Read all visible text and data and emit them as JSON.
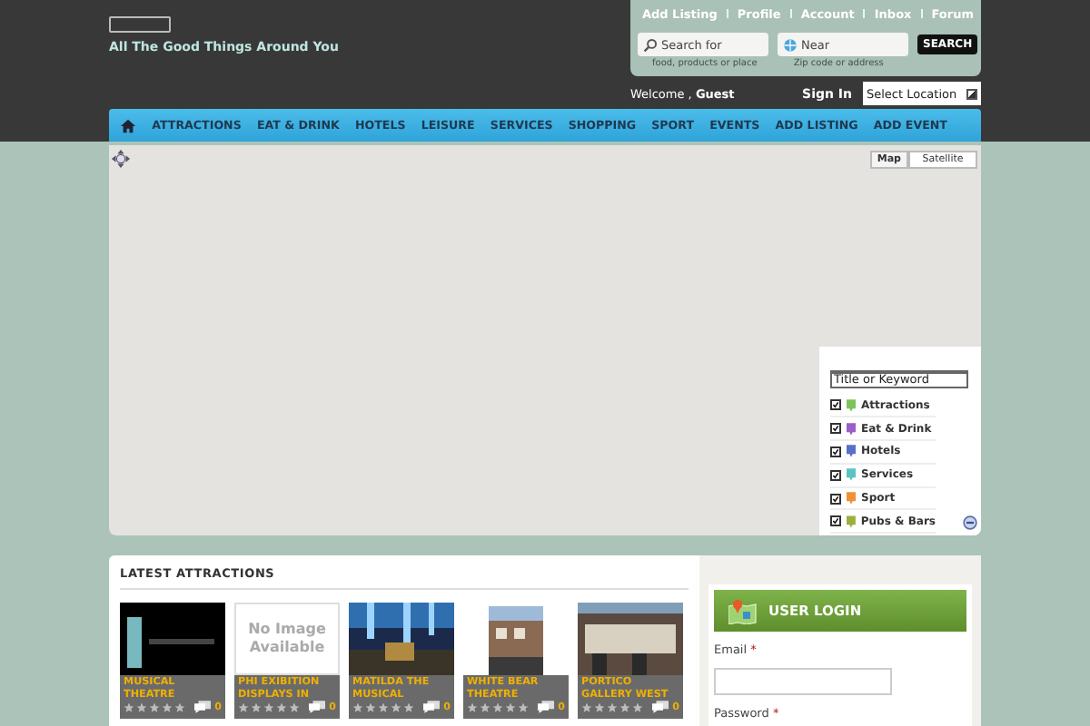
{
  "header": {
    "tagline": "All The Good Things Around You",
    "top_links": [
      "Add Listing",
      "Profile",
      "Account",
      "Inbox",
      "Forum"
    ],
    "search": {
      "what": {
        "placeholder": "Search for",
        "hint": "food, products or place"
      },
      "where": {
        "placeholder": "Near",
        "hint": "Zip code or address"
      },
      "button": "SEARCH"
    },
    "welcome": {
      "label": "Welcome ,",
      "user": "Guest"
    },
    "sign_in": "Sign In",
    "location_select": "Select Location"
  },
  "nav": [
    "ATTRACTIONS",
    "EAT & DRINK",
    "HOTELS",
    "LEISURE",
    "SERVICES",
    "SHOPPING",
    "SPORT",
    "EVENTS",
    "ADD LISTING",
    "ADD EVENT"
  ],
  "map": {
    "types": [
      {
        "label": "Map",
        "selected": true
      },
      {
        "label": "Satellite",
        "selected": false
      }
    ],
    "filter": {
      "placeholder": "Title or Keyword",
      "categories": [
        {
          "label": "Attractions",
          "checked": true,
          "color": "#7cc35a"
        },
        {
          "label": "Eat & Drink",
          "checked": true,
          "color": "#9b5fc8"
        },
        {
          "label": "Hotels",
          "checked": true,
          "color": "#5a6fc8"
        },
        {
          "label": "Services",
          "checked": true,
          "color": "#5ac4c4"
        },
        {
          "label": "Sport",
          "checked": true,
          "color": "#f09038"
        },
        {
          "label": "Pubs & Bars",
          "checked": true,
          "color": "#9ab03a"
        }
      ]
    }
  },
  "latest": {
    "title": "LATEST ATTRACTIONS",
    "items": [
      {
        "kind": "picture",
        "title": "MUSICAL THEATRE",
        "stars": 0,
        "comments": "0"
      },
      {
        "kind": "placeholder",
        "placeholder_text": "No Image Available",
        "title": "PHI EXIBITION DISPLAYS IN",
        "stars": 0,
        "comments": "0"
      },
      {
        "kind": "picture",
        "title": "MATILDA THE MUSICAL",
        "stars": 0,
        "comments": "0"
      },
      {
        "kind": "picture",
        "title": "WHITE BEAR THEATRE",
        "stars": 0,
        "comments": "0"
      },
      {
        "kind": "picture",
        "title": "PORTICO GALLERY WEST",
        "stars": 0,
        "comments": "0"
      }
    ]
  },
  "login": {
    "title": "USER LOGIN",
    "email_label": "Email",
    "email_required": "*",
    "password_label": "Password",
    "password_required": "*"
  }
}
